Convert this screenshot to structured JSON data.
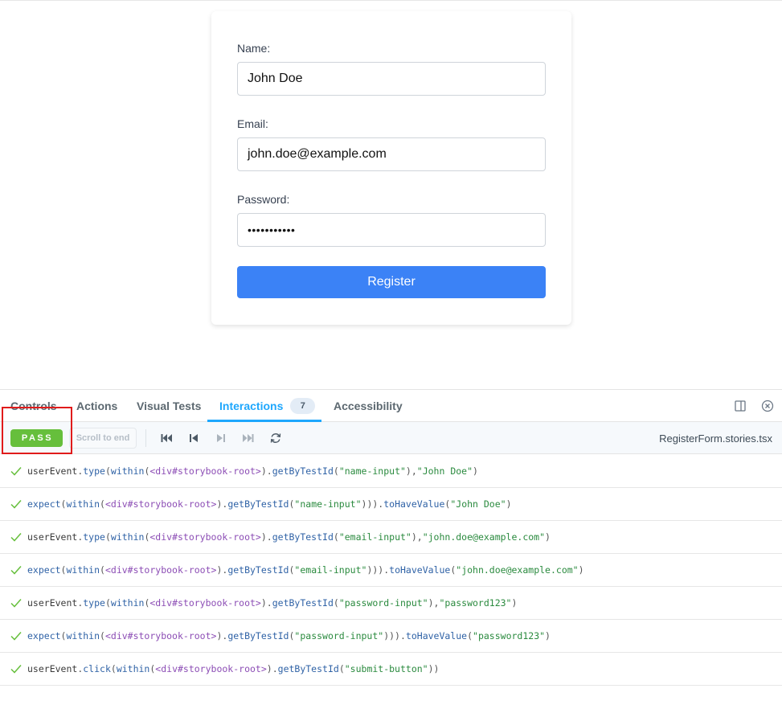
{
  "form": {
    "name_label": "Name:",
    "name_value": "John Doe",
    "email_label": "Email:",
    "email_value": "john.doe@example.com",
    "password_label": "Password:",
    "password_masked": "•••••••••••",
    "register_label": "Register"
  },
  "panel": {
    "tabs": [
      {
        "label": "Controls"
      },
      {
        "label": "Actions"
      },
      {
        "label": "Visual Tests"
      },
      {
        "label": "Interactions",
        "badge": "7"
      },
      {
        "label": "Accessibility"
      }
    ],
    "active_tab": "Interactions",
    "status": "PASS",
    "scroll_label": "Scroll to end",
    "file_name": "RegisterForm.stories.tsx",
    "accent_color": "#1ea7fd",
    "pass_color": "#66bf3c"
  },
  "interactions": [
    {
      "obj": "userEvent",
      "method": "type",
      "testid": "name-input",
      "closing": ", ",
      "assert": "",
      "value": "John Doe"
    },
    {
      "obj": "expect",
      "method": "",
      "testid": "name-input",
      "closing": ")",
      "assert": "toHaveValue",
      "value": "John Doe"
    },
    {
      "obj": "userEvent",
      "method": "type",
      "testid": "email-input",
      "closing": ", ",
      "assert": "",
      "value": "john.doe@example.com"
    },
    {
      "obj": "expect",
      "method": "",
      "testid": "email-input",
      "closing": ")",
      "assert": "toHaveValue",
      "value": "john.doe@example.com"
    },
    {
      "obj": "userEvent",
      "method": "type",
      "testid": "password-input",
      "closing": ", ",
      "assert": "",
      "value": "password123"
    },
    {
      "obj": "expect",
      "method": "",
      "testid": "password-input",
      "closing": ")",
      "assert": "toHaveValue",
      "value": "password123"
    },
    {
      "obj": "userEvent",
      "method": "click",
      "testid": "submit-button",
      "closing": "",
      "assert": "",
      "value": ""
    }
  ],
  "code_tokens": {
    "within": "within",
    "element": "<div#storybook-root>",
    "getter": "getByTestId"
  }
}
